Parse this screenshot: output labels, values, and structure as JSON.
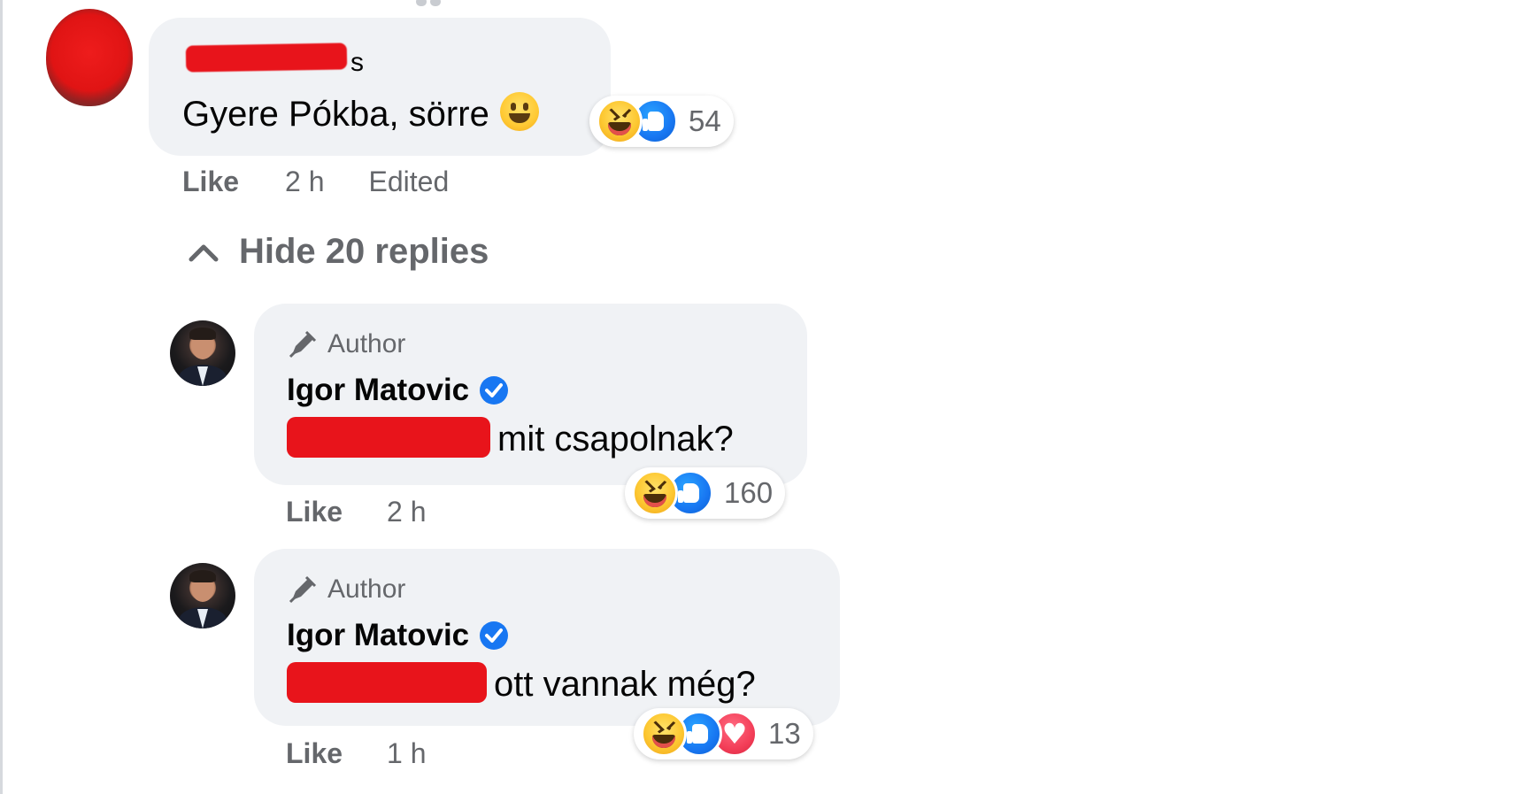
{
  "thread": {
    "comment": {
      "name_visible_suffix": "s",
      "text": "Gyere Pókba, sörre",
      "reactions_count": "54",
      "like_label": "Like",
      "time": "2 h",
      "edited_label": "Edited"
    },
    "hide_replies_label": "Hide 20 replies",
    "replies": [
      {
        "badge": "Author",
        "author": "Igor Matovic",
        "text_visible": "mit csapolnak?",
        "reactions_count": "160",
        "like_label": "Like",
        "time": "2 h"
      },
      {
        "badge": "Author",
        "author": "Igor Matovic",
        "text_visible": "ott vannak még?",
        "reactions_count": "13",
        "like_label": "Like",
        "time": "1 h"
      }
    ]
  },
  "colors": {
    "bubble": "#f0f2f5",
    "secondary_text": "#65676b",
    "redaction": "#e8141b",
    "verified": "#1877f2"
  },
  "icons": [
    "pen-icon",
    "verified-icon",
    "chevron-up-icon",
    "haha-reaction-icon",
    "like-reaction-icon",
    "love-reaction-icon",
    "smiley-emoji-icon"
  ]
}
